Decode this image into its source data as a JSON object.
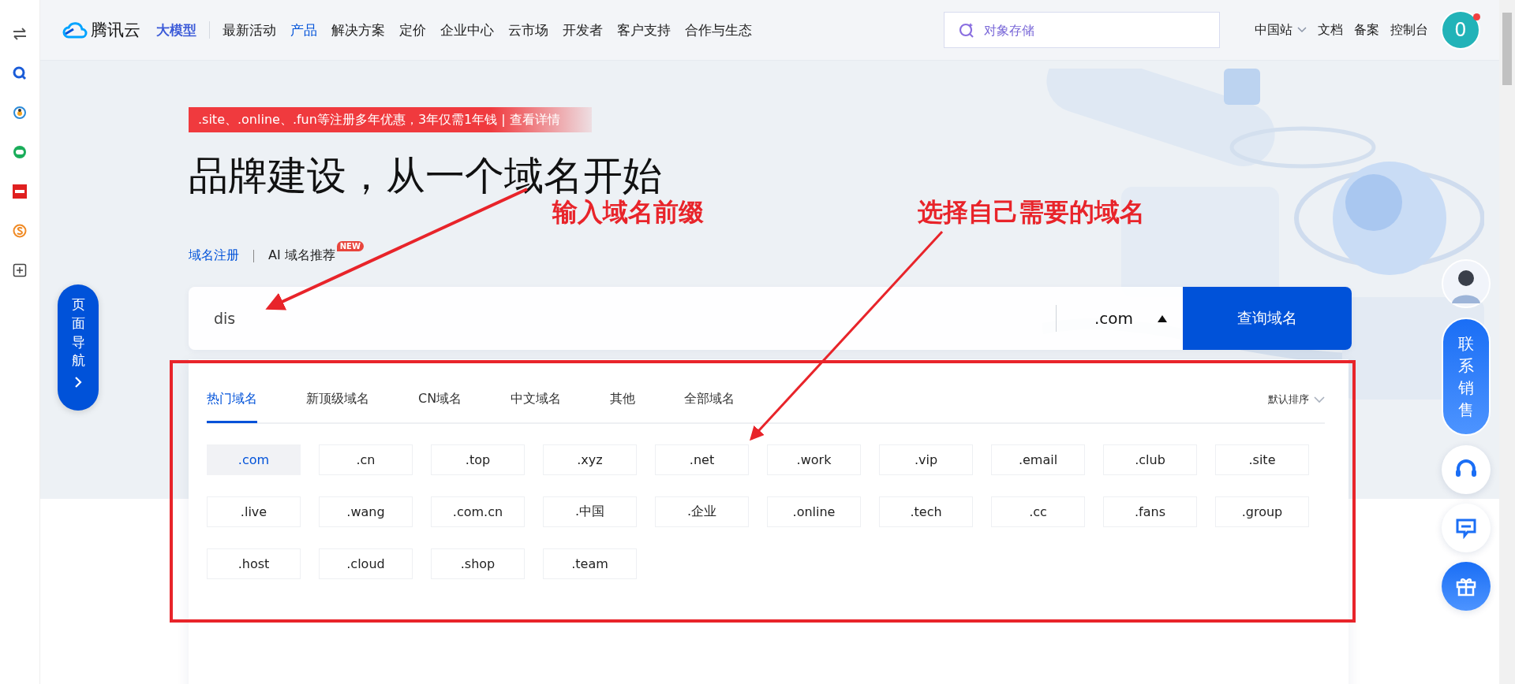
{
  "nav": {
    "logo": "腾讯云",
    "highlight": "大模型",
    "items": [
      {
        "label": "最新活动",
        "selected": false
      },
      {
        "label": "产品",
        "selected": true
      },
      {
        "label": "解决方案",
        "selected": false
      },
      {
        "label": "定价",
        "selected": false
      },
      {
        "label": "企业中心",
        "selected": false
      },
      {
        "label": "云市场",
        "selected": false
      },
      {
        "label": "开发者",
        "selected": false
      },
      {
        "label": "客户支持",
        "selected": false
      },
      {
        "label": "合作与生态",
        "selected": false
      }
    ],
    "search": {
      "placeholder": "对象存储"
    },
    "region": "中国站",
    "links": [
      "文档",
      "备案",
      "控制台"
    ],
    "avatar": "0",
    "notification": true
  },
  "promo": ".site、.online、.fun等注册多年优惠，3年仅需1年钱 | 查看详情",
  "title": "品牌建设，从一个域名开始",
  "subtabs": [
    {
      "label": "域名注册",
      "selected": true
    },
    {
      "label": "AI 域名推荐",
      "selected": false,
      "badge": "NEW"
    }
  ],
  "search": {
    "value": "dis",
    "suffix": ".com",
    "button": "查询域名"
  },
  "panel": {
    "tabs": [
      {
        "label": "热门域名",
        "selected": true
      },
      {
        "label": "新顶级域名",
        "selected": false
      },
      {
        "label": "CN域名",
        "selected": false
      },
      {
        "label": "中文域名",
        "selected": false
      },
      {
        "label": "其他",
        "selected": false
      },
      {
        "label": "全部域名",
        "selected": false
      }
    ],
    "sort": "默认排序",
    "domains": [
      {
        "label": ".com",
        "selected": true
      },
      {
        "label": ".cn",
        "selected": false
      },
      {
        "label": ".top",
        "selected": false
      },
      {
        "label": ".xyz",
        "selected": false
      },
      {
        "label": ".net",
        "selected": false
      },
      {
        "label": ".work",
        "selected": false
      },
      {
        "label": ".vip",
        "selected": false
      },
      {
        "label": ".email",
        "selected": false
      },
      {
        "label": ".club",
        "selected": false
      },
      {
        "label": ".site",
        "selected": false
      },
      {
        "label": ".live",
        "selected": false
      },
      {
        "label": ".wang",
        "selected": false
      },
      {
        "label": ".com.cn",
        "selected": false
      },
      {
        "label": ".中国",
        "selected": false
      },
      {
        "label": ".企业",
        "selected": false
      },
      {
        "label": ".online",
        "selected": false
      },
      {
        "label": ".tech",
        "selected": false
      },
      {
        "label": ".cc",
        "selected": false
      },
      {
        "label": ".fans",
        "selected": false
      },
      {
        "label": ".group",
        "selected": false
      },
      {
        "label": ".host",
        "selected": false
      },
      {
        "label": ".cloud",
        "selected": false
      },
      {
        "label": ".shop",
        "selected": false
      },
      {
        "label": ".team",
        "selected": false
      }
    ]
  },
  "page_nav": "页面导航",
  "contact": "联系销售",
  "annotations": [
    {
      "text": "输入域名前缀"
    },
    {
      "text": "选择自己需要的域名"
    }
  ]
}
